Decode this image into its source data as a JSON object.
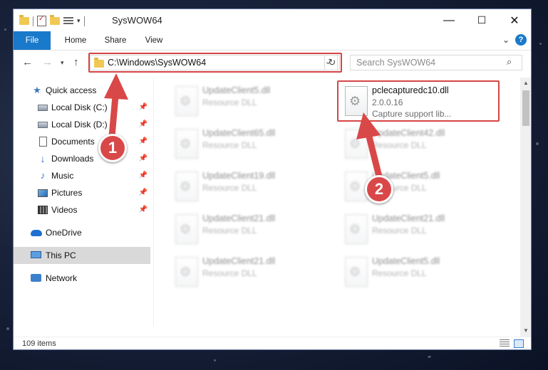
{
  "window": {
    "title": "SysWOW64",
    "controls": {
      "minimize": "—",
      "maximize": "☐",
      "close": "✕"
    }
  },
  "ribbon": {
    "tabs": [
      {
        "label": "File"
      },
      {
        "label": "Home"
      },
      {
        "label": "Share"
      },
      {
        "label": "View"
      }
    ],
    "expand_icon": "chevron-down-icon",
    "help_label": "?"
  },
  "navigation": {
    "address_path": "C:\\Windows\\SysWOW64",
    "search_placeholder": "Search SysWOW64"
  },
  "sidebar": {
    "items": [
      {
        "label": "Quick access",
        "icon": "star-icon",
        "pinned": false
      },
      {
        "label": "Local Disk (C:)",
        "icon": "drive-icon",
        "pinned": true
      },
      {
        "label": "Local Disk (D:)",
        "icon": "drive-icon",
        "pinned": true
      },
      {
        "label": "Documents",
        "icon": "documents-icon",
        "pinned": true
      },
      {
        "label": "Downloads",
        "icon": "downloads-icon",
        "pinned": true
      },
      {
        "label": "Music",
        "icon": "music-icon",
        "pinned": true
      },
      {
        "label": "Pictures",
        "icon": "pictures-icon",
        "pinned": true
      },
      {
        "label": "Videos",
        "icon": "videos-icon",
        "pinned": true
      },
      {
        "label": "OneDrive",
        "icon": "onedrive-icon",
        "pinned": false
      },
      {
        "label": "This PC",
        "icon": "this-pc-icon",
        "pinned": false,
        "selected": true
      },
      {
        "label": "Network",
        "icon": "network-icon",
        "pinned": false
      }
    ]
  },
  "files": {
    "highlighted": {
      "name": "pclecapturedc10.dll",
      "version": "2.0.0.16",
      "description": "Capture support lib..."
    },
    "others": [
      {
        "name": "UpdateClient5.dll",
        "type": "Resource DLL"
      },
      {
        "name": "UpdateClient65.dll",
        "type": "Resource DLL"
      },
      {
        "name": "UpdateClient42.dll",
        "type": "Resource DLL"
      },
      {
        "name": "UpdateClient19.dll",
        "type": "Resource DLL"
      },
      {
        "name": "UpdateClient5.dll",
        "type": "Resource DLL"
      },
      {
        "name": "UpdateClient21.dll",
        "type": "Resource DLL"
      },
      {
        "name": "UpdateClient21.dll",
        "type": "Resource DLL"
      },
      {
        "name": "UpdateClient21.dll",
        "type": "Resource DLL"
      },
      {
        "name": "UpdateClient5.dll",
        "type": "Resource DLL"
      }
    ]
  },
  "status": {
    "item_count": "109 items"
  },
  "annotations": {
    "step1": "1",
    "step2": "2",
    "highlight_color": "#d64545",
    "badge_color": "#d94848"
  },
  "colors": {
    "accent": "#1979ca",
    "selected_nav": "#d9d9d9"
  }
}
